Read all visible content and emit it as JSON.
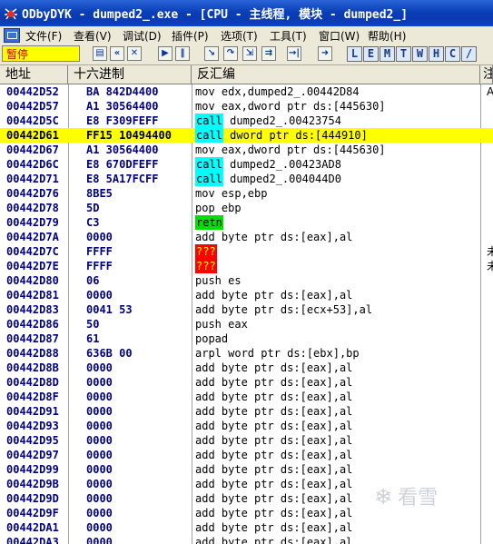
{
  "window": {
    "title": "ODbyDYK - dumped2_.exe - [CPU - 主线程, 模块 - dumped2_]"
  },
  "menu": [
    {
      "label": "文件(F)"
    },
    {
      "label": "查看(V)"
    },
    {
      "label": "调试(D)"
    },
    {
      "label": "插件(P)"
    },
    {
      "label": "选项(T)"
    },
    {
      "label": "工具(T)"
    },
    {
      "label": "窗口(W)"
    },
    {
      "label": "帮助(H)"
    }
  ],
  "toolbar": {
    "status": "暂停",
    "buttons": [
      {
        "icon": "open-icon",
        "glyph": "▤"
      },
      {
        "icon": "rewind-icon",
        "glyph": "«"
      },
      {
        "icon": "close-icon",
        "glyph": "✕"
      },
      {
        "icon": "run-icon",
        "glyph": "▶"
      },
      {
        "icon": "pause-icon",
        "glyph": "‖"
      },
      {
        "icon": "step-into-icon",
        "glyph": "↘"
      },
      {
        "icon": "step-over-icon",
        "glyph": "↷"
      },
      {
        "icon": "trace-into-icon",
        "glyph": "⇲"
      },
      {
        "icon": "trace-over-icon",
        "glyph": "⇉"
      },
      {
        "icon": "execute-till-return-icon",
        "glyph": "→|"
      },
      {
        "icon": "goto-icon",
        "glyph": "➜"
      }
    ],
    "letter_buttons": [
      "L",
      "E",
      "M",
      "T",
      "W",
      "H",
      "C",
      "/"
    ]
  },
  "columns": {
    "address": "地址",
    "hex": "十六进制",
    "disasm": "反汇编",
    "comment": "注"
  },
  "rows": [
    {
      "addr": "00442D52",
      "hex": "BA 842D4400",
      "pre": "",
      "kw": "",
      "kwtype": "",
      "post": "mov edx,dumped2_.00442D84",
      "cmt": "A"
    },
    {
      "addr": "00442D57",
      "hex": "A1 30564400",
      "pre": "",
      "kw": "",
      "kwtype": "",
      "post": "mov eax,dword ptr ds:[445630]",
      "cmt": ""
    },
    {
      "addr": "00442D5C",
      "hex": "E8 F309FEFF",
      "pre": "",
      "kw": "call",
      "kwtype": "call",
      "post": " dumped2_.00423754",
      "cmt": ""
    },
    {
      "addr": "00442D61",
      "hex": "FF15 10494400",
      "pre": "",
      "kw": "call",
      "kwtype": "call",
      "post": " dword ptr ds:[444910]",
      "cmt": "",
      "sel": true
    },
    {
      "addr": "00442D67",
      "hex": "A1 30564400",
      "pre": "",
      "kw": "",
      "kwtype": "",
      "post": "mov eax,dword ptr ds:[445630]",
      "cmt": ""
    },
    {
      "addr": "00442D6C",
      "hex": "E8 670DFEFF",
      "pre": "",
      "kw": "call",
      "kwtype": "call",
      "post": " dumped2_.00423AD8",
      "cmt": ""
    },
    {
      "addr": "00442D71",
      "hex": "E8 5A17FCFF",
      "pre": "",
      "kw": "call",
      "kwtype": "call",
      "post": " dumped2_.004044D0",
      "cmt": ""
    },
    {
      "addr": "00442D76",
      "hex": "8BE5",
      "pre": "",
      "kw": "",
      "kwtype": "",
      "post": "mov esp,ebp",
      "cmt": ""
    },
    {
      "addr": "00442D78",
      "hex": "5D",
      "pre": "",
      "kw": "",
      "kwtype": "",
      "post": "pop ebp",
      "cmt": ""
    },
    {
      "addr": "00442D79",
      "hex": "C3",
      "pre": "",
      "kw": "retn",
      "kwtype": "retn",
      "post": "",
      "cmt": ""
    },
    {
      "addr": "00442D7A",
      "hex": "0000",
      "pre": "",
      "kw": "",
      "kwtype": "",
      "post": "add byte ptr ds:[eax],al",
      "cmt": ""
    },
    {
      "addr": "00442D7C",
      "hex": "FFFF",
      "pre": "",
      "kw": "???",
      "kwtype": "bad",
      "post": "",
      "cmt": "未"
    },
    {
      "addr": "00442D7E",
      "hex": "FFFF",
      "pre": "",
      "kw": "???",
      "kwtype": "bad",
      "post": "",
      "cmt": "未"
    },
    {
      "addr": "00442D80",
      "hex": "06",
      "pre": "",
      "kw": "",
      "kwtype": "",
      "post": "push es",
      "cmt": ""
    },
    {
      "addr": "00442D81",
      "hex": "0000",
      "pre": "",
      "kw": "",
      "kwtype": "",
      "post": "add byte ptr ds:[eax],al",
      "cmt": ""
    },
    {
      "addr": "00442D83",
      "hex": "0041 53",
      "pre": "",
      "kw": "",
      "kwtype": "",
      "post": "add byte ptr ds:[ecx+53],al",
      "cmt": ""
    },
    {
      "addr": "00442D86",
      "hex": "50",
      "pre": "",
      "kw": "",
      "kwtype": "",
      "post": "push eax",
      "cmt": ""
    },
    {
      "addr": "00442D87",
      "hex": "61",
      "pre": "",
      "kw": "",
      "kwtype": "",
      "post": "popad",
      "cmt": ""
    },
    {
      "addr": "00442D88",
      "hex": "636B 00",
      "pre": "",
      "kw": "",
      "kwtype": "",
      "post": "arpl word ptr ds:[ebx],bp",
      "cmt": ""
    },
    {
      "addr": "00442D8B",
      "hex": "0000",
      "pre": "",
      "kw": "",
      "kwtype": "",
      "post": "add byte ptr ds:[eax],al",
      "cmt": ""
    },
    {
      "addr": "00442D8D",
      "hex": "0000",
      "pre": "",
      "kw": "",
      "kwtype": "",
      "post": "add byte ptr ds:[eax],al",
      "cmt": ""
    },
    {
      "addr": "00442D8F",
      "hex": "0000",
      "pre": "",
      "kw": "",
      "kwtype": "",
      "post": "add byte ptr ds:[eax],al",
      "cmt": ""
    },
    {
      "addr": "00442D91",
      "hex": "0000",
      "pre": "",
      "kw": "",
      "kwtype": "",
      "post": "add byte ptr ds:[eax],al",
      "cmt": ""
    },
    {
      "addr": "00442D93",
      "hex": "0000",
      "pre": "",
      "kw": "",
      "kwtype": "",
      "post": "add byte ptr ds:[eax],al",
      "cmt": ""
    },
    {
      "addr": "00442D95",
      "hex": "0000",
      "pre": "",
      "kw": "",
      "kwtype": "",
      "post": "add byte ptr ds:[eax],al",
      "cmt": ""
    },
    {
      "addr": "00442D97",
      "hex": "0000",
      "pre": "",
      "kw": "",
      "kwtype": "",
      "post": "add byte ptr ds:[eax],al",
      "cmt": ""
    },
    {
      "addr": "00442D99",
      "hex": "0000",
      "pre": "",
      "kw": "",
      "kwtype": "",
      "post": "add byte ptr ds:[eax],al",
      "cmt": ""
    },
    {
      "addr": "00442D9B",
      "hex": "0000",
      "pre": "",
      "kw": "",
      "kwtype": "",
      "post": "add byte ptr ds:[eax],al",
      "cmt": ""
    },
    {
      "addr": "00442D9D",
      "hex": "0000",
      "pre": "",
      "kw": "",
      "kwtype": "",
      "post": "add byte ptr ds:[eax],al",
      "cmt": ""
    },
    {
      "addr": "00442D9F",
      "hex": "0000",
      "pre": "",
      "kw": "",
      "kwtype": "",
      "post": "add byte ptr ds:[eax],al",
      "cmt": ""
    },
    {
      "addr": "00442DA1",
      "hex": "0000",
      "pre": "",
      "kw": "",
      "kwtype": "",
      "post": "add byte ptr ds:[eax],al",
      "cmt": ""
    },
    {
      "addr": "00442DA3",
      "hex": "0000",
      "pre": "",
      "kw": "",
      "kwtype": "",
      "post": "add byte ptr ds:[eax],al",
      "cmt": ""
    }
  ],
  "watermark": {
    "text": "看雪"
  }
}
